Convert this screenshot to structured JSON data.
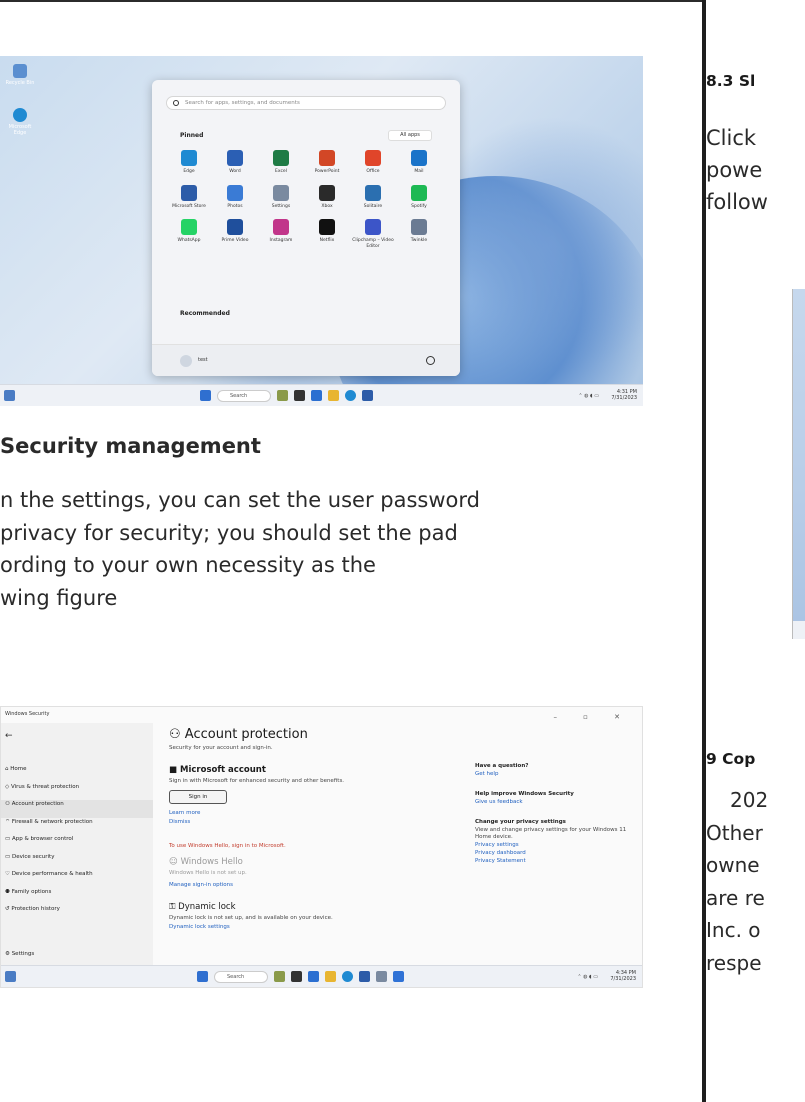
{
  "left": {
    "start_menu_screenshot": {
      "desktop_icons": [
        "Recycle Bin",
        "Microsoft Edge"
      ],
      "search_placeholder": "Search for apps, settings, and documents",
      "pinned_label": "Pinned",
      "all_apps_label": "All apps",
      "apps": [
        {
          "label": "Edge",
          "color": "#1f8ad2"
        },
        {
          "label": "Word",
          "color": "#2b5fb4"
        },
        {
          "label": "Excel",
          "color": "#1e7b45"
        },
        {
          "label": "PowerPoint",
          "color": "#d24726"
        },
        {
          "label": "Office",
          "color": "#e0452a"
        },
        {
          "label": "Mail",
          "color": "#1a73c9"
        },
        {
          "label": "Microsoft Store",
          "color": "#2d5ca8"
        },
        {
          "label": "Photos",
          "color": "#3a7bd5"
        },
        {
          "label": "Settings",
          "color": "#7a8aa0"
        },
        {
          "label": "Xbox",
          "color": "#2a2a2a"
        },
        {
          "label": "Solitaire",
          "color": "#2b6fb0"
        },
        {
          "label": "Spotify",
          "color": "#1db954"
        },
        {
          "label": "WhatsApp",
          "color": "#25d366"
        },
        {
          "label": "Prime Video",
          "color": "#1f4f9c"
        },
        {
          "label": "Instagram",
          "color": "#c1358a"
        },
        {
          "label": "Netflix",
          "color": "#111111"
        },
        {
          "label": "Clipchamp – Video Editor",
          "color": "#3c55c8"
        },
        {
          "label": "Twinkle",
          "color": "#6b7b93"
        }
      ],
      "recommended_label": "Recommended",
      "user_name": "test",
      "taskbar_search": "Search",
      "tray_time": "4:31 PM",
      "tray_date": "7/31/2023"
    },
    "section_title": "Security management",
    "body_lines": [
      "n the settings, you can set the user password",
      " privacy for security; you should set the pad",
      "ording to your own necessity as the",
      "wing figure"
    ],
    "security_screenshot": {
      "window_title": "Windows Security",
      "nav_items": [
        "Home",
        "Virus & threat protection",
        "Account protection",
        "Firewall & network protection",
        "App & browser control",
        "Device security",
        "Device performance & health",
        "Family options",
        "Protection history"
      ],
      "settings_label": "Settings",
      "heading": "Account protection",
      "subheading": "Security for your account and sign-in.",
      "ms_account_title": "Microsoft account",
      "ms_account_desc": "Sign in with Microsoft for enhanced security and other benefits.",
      "sign_in_button": "Sign in",
      "learn_more": "Learn more",
      "dismiss": "Dismiss",
      "hello_warning": "To use Windows Hello, sign in to Microsoft.",
      "hello_title": "Windows Hello",
      "hello_desc": "Windows Hello is not set up.",
      "hello_link": "Manage sign-in options",
      "dynamic_lock_title": "Dynamic lock",
      "dynamic_lock_desc": "Dynamic lock is not set up, and is available on your device.",
      "dynamic_lock_link": "Dynamic lock settings",
      "right_question": "Have a question?",
      "right_help": "Get help",
      "right_improve": "Help improve Windows Security",
      "right_feedback": "Give us feedback",
      "right_privacy": "Change your privacy settings",
      "right_privacy_desc": "View and change privacy settings for your Windows 11 Home device.",
      "right_links": [
        "Privacy settings",
        "Privacy dashboard",
        "Privacy Statement"
      ],
      "taskbar_search": "Search",
      "tray_time": "4:34 PM",
      "tray_date": "7/31/2023"
    }
  },
  "right": {
    "heading": "8.3 Sl",
    "body_lines": [
      "Click",
      "powe",
      "follow"
    ],
    "heading2": "9 Cop",
    "body2_lines": [
      "202",
      "Other",
      "owne",
      "are re",
      "Inc. o",
      "respe"
    ]
  }
}
